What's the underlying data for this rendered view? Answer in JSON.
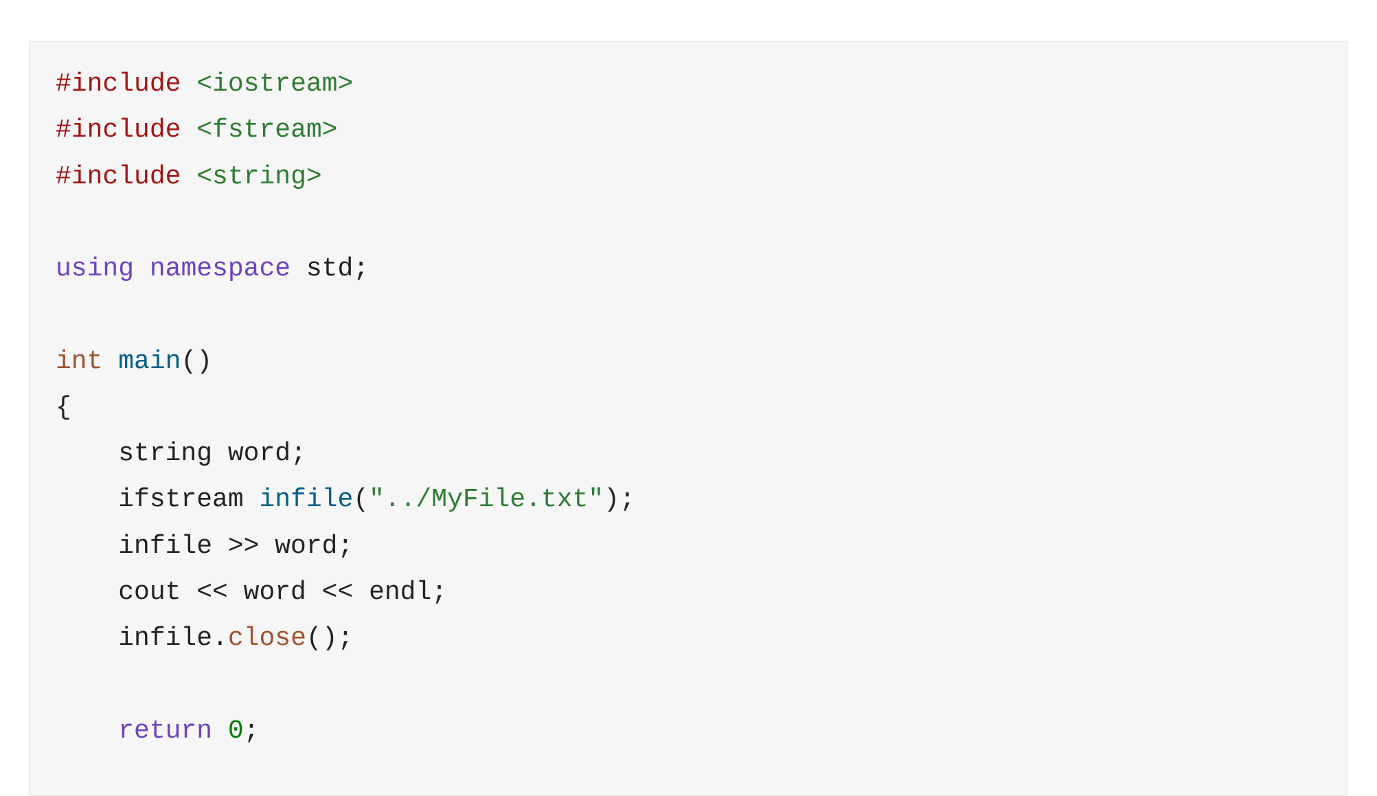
{
  "code": {
    "line1": {
      "directive": "#include",
      "target": " <iostream>"
    },
    "line2": {
      "directive": "#include",
      "target": " <fstream>"
    },
    "line3": {
      "directive": "#include",
      "target": " <string>"
    },
    "line5": {
      "kw_using": "using",
      "kw_namespace": " namespace",
      "ident_std": " std",
      "semi": ";"
    },
    "line7": {
      "type_int": "int",
      "func_main": " main",
      "parens": "()"
    },
    "line8": {
      "brace_open": "{"
    },
    "line9": {
      "indent": "    ",
      "ident": "string word",
      "semi": ";"
    },
    "line10": {
      "indent": "    ",
      "ident_ifstream": "ifstream ",
      "ctor": "infile",
      "paren_open": "(",
      "str": "\"../MyFile.txt\"",
      "paren_close_semi": ");"
    },
    "line11": {
      "indent": "    ",
      "text": "infile >> word",
      "semi": ";"
    },
    "line12": {
      "indent": "    ",
      "text": "cout << word << endl",
      "semi": ";"
    },
    "line13": {
      "indent": "    ",
      "obj": "infile.",
      "method": "close",
      "tail": "();"
    },
    "line15": {
      "indent": "    ",
      "kw_return": "return",
      "space": " ",
      "num": "0",
      "semi": ";"
    }
  }
}
